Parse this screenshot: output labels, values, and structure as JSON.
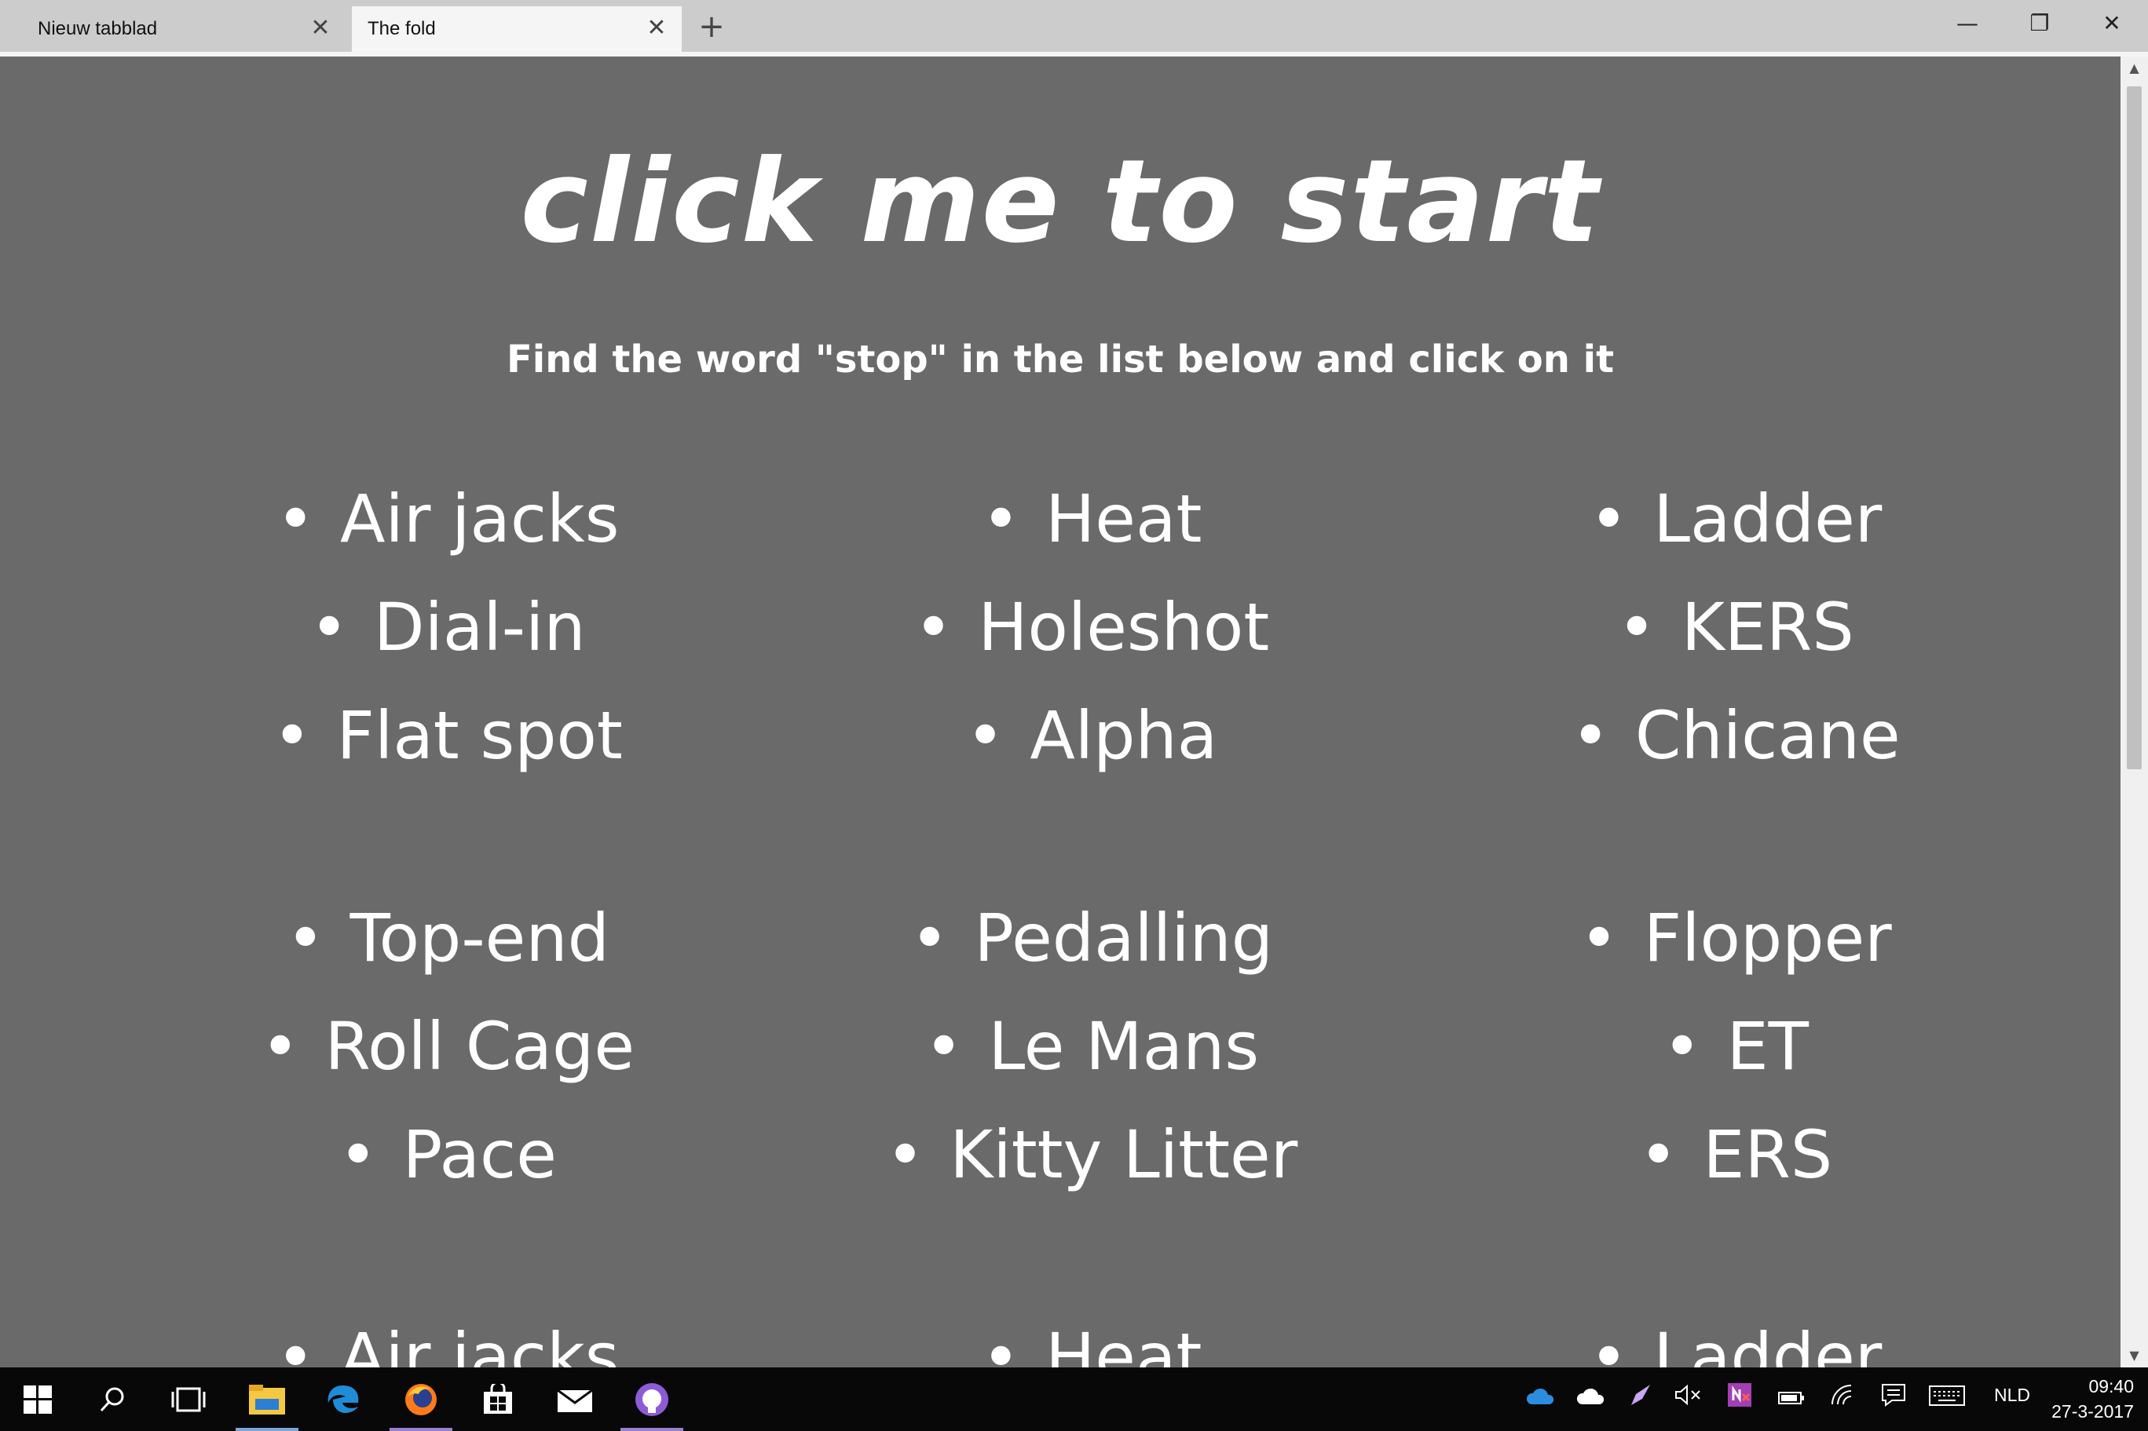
{
  "browser": {
    "tabs": [
      {
        "label": "Nieuw tabblad",
        "active": false
      },
      {
        "label": "The fold",
        "active": true
      }
    ],
    "new_tab_symbol": "+",
    "close_symbol": "✕",
    "window_controls": {
      "minimize": "—",
      "restore": "❐",
      "close": "✕"
    }
  },
  "page": {
    "title": "click me to start",
    "instruction": "Find the word \"stop\" in the list below and click on it",
    "background_color": "#6a6a6a",
    "text_color": "#ffffff",
    "lists": [
      [
        "Air jacks",
        "Dial-in",
        "Flat spot"
      ],
      [
        "Heat",
        "Holeshot",
        "Alpha"
      ],
      [
        "Ladder",
        "KERS",
        "Chicane"
      ],
      [
        "Top-end",
        "Roll Cage",
        "Pace"
      ],
      [
        "Pedalling",
        "Le Mans",
        "Kitty Litter"
      ],
      [
        "Flopper",
        "ET",
        "ERS"
      ],
      [
        "Air jacks"
      ],
      [
        "Heat"
      ],
      [
        "Ladder"
      ]
    ]
  },
  "taskbar": {
    "icons": [
      "windows-start-icon",
      "search-icon",
      "task-view-icon",
      "file-explorer-icon",
      "edge-icon",
      "firefox-icon",
      "store-icon",
      "mail-icon",
      "github-icon"
    ],
    "tray_icons": [
      "onedrive-icon",
      "cloud-icon",
      "pen-icon",
      "volume-muted-icon",
      "onenote-icon",
      "battery-icon",
      "wifi-icon",
      "action-center-icon",
      "keyboard-icon"
    ],
    "language": "NLD",
    "time": "09:40",
    "date": "27-3-2017"
  }
}
